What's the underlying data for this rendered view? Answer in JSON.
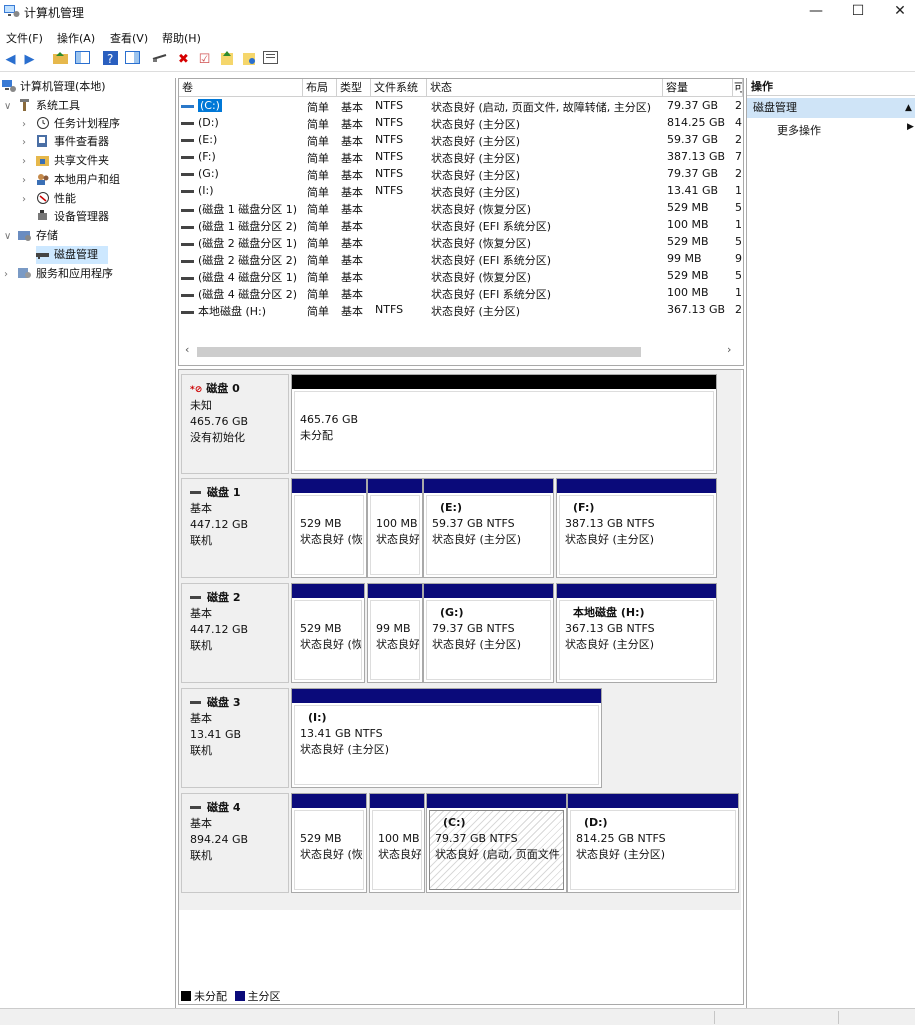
{
  "window": {
    "title": "计算机管理",
    "min_glyph": "—",
    "max_glyph": "☐",
    "close_glyph": "✕"
  },
  "menu": [
    "文件(F)",
    "操作(A)",
    "查看(V)",
    "帮助(H)"
  ],
  "toolbar": [
    "back-icon",
    "forward-icon",
    "up-folder-icon",
    "show-tree-icon",
    "help-icon",
    "show-pane-icon",
    "connect-icon",
    "delete-icon",
    "check-icon",
    "import-icon",
    "export-icon",
    "properties-icon"
  ],
  "tree": {
    "root": "计算机管理(本地)",
    "system_tools": "系统工具",
    "task_scheduler": "任务计划程序",
    "event_viewer": "事件查看器",
    "shared_folders": "共享文件夹",
    "local_users": "本地用户和组",
    "performance": "性能",
    "device_manager": "设备管理器",
    "storage": "存储",
    "disk_management": "磁盘管理",
    "services": "服务和应用程序"
  },
  "volume_list": {
    "columns": [
      "卷",
      "布局",
      "类型",
      "文件系统",
      "状态",
      "容量",
      "可"
    ],
    "rows": [
      {
        "vol": "(C:)",
        "layout": "简单",
        "type": "基本",
        "fs": "NTFS",
        "status": "状态良好 (启动, 页面文件, 故障转储, 主分区)",
        "cap": "79.37 GB",
        "free": "2"
      },
      {
        "vol": "(D:)",
        "layout": "简单",
        "type": "基本",
        "fs": "NTFS",
        "status": "状态良好 (主分区)",
        "cap": "814.25 GB",
        "free": "4"
      },
      {
        "vol": "(E:)",
        "layout": "简单",
        "type": "基本",
        "fs": "NTFS",
        "status": "状态良好 (主分区)",
        "cap": "59.37 GB",
        "free": "2"
      },
      {
        "vol": "(F:)",
        "layout": "简单",
        "type": "基本",
        "fs": "NTFS",
        "status": "状态良好 (主分区)",
        "cap": "387.13 GB",
        "free": "7"
      },
      {
        "vol": "(G:)",
        "layout": "简单",
        "type": "基本",
        "fs": "NTFS",
        "status": "状态良好 (主分区)",
        "cap": "79.37 GB",
        "free": "2"
      },
      {
        "vol": "(I:)",
        "layout": "简单",
        "type": "基本",
        "fs": "NTFS",
        "status": "状态良好 (主分区)",
        "cap": "13.41 GB",
        "free": "1"
      },
      {
        "vol": "(磁盘 1 磁盘分区 1)",
        "layout": "简单",
        "type": "基本",
        "fs": "",
        "status": "状态良好 (恢复分区)",
        "cap": "529 MB",
        "free": "5"
      },
      {
        "vol": "(磁盘 1 磁盘分区 2)",
        "layout": "简单",
        "type": "基本",
        "fs": "",
        "status": "状态良好 (EFI 系统分区)",
        "cap": "100 MB",
        "free": "1"
      },
      {
        "vol": "(磁盘 2 磁盘分区 1)",
        "layout": "简单",
        "type": "基本",
        "fs": "",
        "status": "状态良好 (恢复分区)",
        "cap": "529 MB",
        "free": "5"
      },
      {
        "vol": "(磁盘 2 磁盘分区 2)",
        "layout": "简单",
        "type": "基本",
        "fs": "",
        "status": "状态良好 (EFI 系统分区)",
        "cap": "99 MB",
        "free": "9"
      },
      {
        "vol": "(磁盘 4 磁盘分区 1)",
        "layout": "简单",
        "type": "基本",
        "fs": "",
        "status": "状态良好 (恢复分区)",
        "cap": "529 MB",
        "free": "5"
      },
      {
        "vol": "(磁盘 4 磁盘分区 2)",
        "layout": "简单",
        "type": "基本",
        "fs": "",
        "status": "状态良好 (EFI 系统分区)",
        "cap": "100 MB",
        "free": "1"
      },
      {
        "vol": "本地磁盘 (H:)",
        "layout": "简单",
        "type": "基本",
        "fs": "NTFS",
        "status": "状态良好 (主分区)",
        "cap": "367.13 GB",
        "free": "2"
      }
    ]
  },
  "disks": [
    {
      "name": "磁盘 0",
      "kind": "未知",
      "size": "465.76 GB",
      "state": "没有初始化",
      "unknown": true,
      "parts": [
        {
          "name": "",
          "size": "465.76 GB",
          "status": "未分配",
          "unalloc": true
        }
      ]
    },
    {
      "name": "磁盘 1",
      "kind": "基本",
      "size": "447.12 GB",
      "state": "联机",
      "parts": [
        {
          "name": "",
          "size": "529 MB",
          "status": "状态良好 (恢"
        },
        {
          "name": "",
          "size": "100 MB",
          "status": "状态良好"
        },
        {
          "name": "(E:)",
          "size": "59.37 GB NTFS",
          "status": "状态良好 (主分区)"
        },
        {
          "name": "(F:)",
          "size": "387.13 GB NTFS",
          "status": "状态良好 (主分区)"
        }
      ]
    },
    {
      "name": "磁盘 2",
      "kind": "基本",
      "size": "447.12 GB",
      "state": "联机",
      "parts": [
        {
          "name": "",
          "size": "529 MB",
          "status": "状态良好 (恢"
        },
        {
          "name": "",
          "size": "99 MB",
          "status": "状态良好"
        },
        {
          "name": "(G:)",
          "size": "79.37 GB NTFS",
          "status": "状态良好 (主分区)"
        },
        {
          "name": "本地磁盘 (H:)",
          "size": "367.13 GB NTFS",
          "status": "状态良好 (主分区)"
        }
      ]
    },
    {
      "name": "磁盘 3",
      "kind": "基本",
      "size": "13.41 GB",
      "state": "联机",
      "parts": [
        {
          "name": "(I:)",
          "size": "13.41 GB NTFS",
          "status": "状态良好 (主分区)"
        }
      ]
    },
    {
      "name": "磁盘 4",
      "kind": "基本",
      "size": "894.24 GB",
      "state": "联机",
      "parts": [
        {
          "name": "",
          "size": "529 MB",
          "status": "状态良好 (恢"
        },
        {
          "name": "",
          "size": "100 MB",
          "status": "状态良好"
        },
        {
          "name": "(C:)",
          "size": "79.37 GB NTFS",
          "status": "状态良好 (启动, 页面文件",
          "selected": true
        },
        {
          "name": "(D:)",
          "size": "814.25 GB NTFS",
          "status": "状态良好 (主分区)"
        }
      ]
    }
  ],
  "legend": {
    "unallocated": "未分配",
    "primary": "主分区",
    "unallocated_color": "#000000",
    "primary_color": "#0a0a7a"
  },
  "actions": {
    "header": "操作",
    "section": "磁盘管理",
    "more": "更多操作"
  }
}
